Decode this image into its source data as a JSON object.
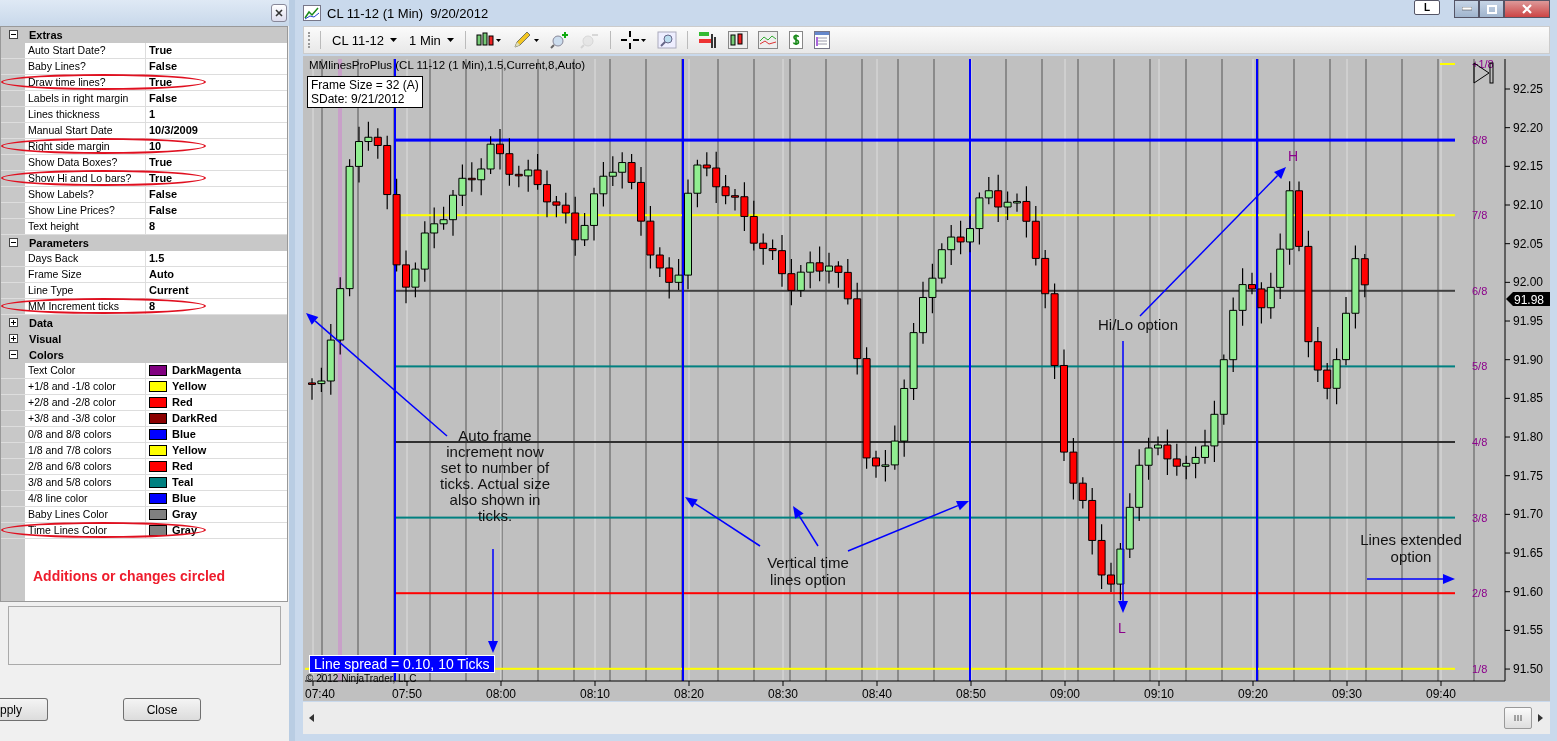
{
  "settings_panel": {
    "groups": [
      {
        "name": "Extras",
        "expanded": true,
        "rows": [
          {
            "label": "Auto Start Date?",
            "value": "True",
            "circled": false
          },
          {
            "label": "Baby Lines?",
            "value": "False",
            "circled": false
          },
          {
            "label": "Draw time lines?",
            "value": "True",
            "circled": true
          },
          {
            "label": "Labels in right margin",
            "value": "False",
            "circled": false
          },
          {
            "label": "Lines thickness",
            "value": "1",
            "circled": false
          },
          {
            "label": "Manual Start Date",
            "value": "10/3/2009",
            "circled": false
          },
          {
            "label": "Right side margin",
            "value": "10",
            "circled": true
          },
          {
            "label": "Show Data Boxes?",
            "value": "True",
            "circled": false
          },
          {
            "label": "Show Hi and Lo bars?",
            "value": "True",
            "circled": true
          },
          {
            "label": "Show Labels?",
            "value": "False",
            "circled": false
          },
          {
            "label": "Show Line Prices?",
            "value": "False",
            "circled": false
          },
          {
            "label": "Text height",
            "value": "8",
            "circled": false
          }
        ]
      },
      {
        "name": "Parameters",
        "expanded": true,
        "rows": [
          {
            "label": "Days Back",
            "value": "1.5",
            "circled": false
          },
          {
            "label": "Frame Size",
            "value": "Auto",
            "circled": false
          },
          {
            "label": "Line Type",
            "value": "Current",
            "circled": false
          },
          {
            "label": "MM Increment ticks",
            "value": "8",
            "circled": true
          }
        ]
      },
      {
        "name": "Data",
        "expanded": false
      },
      {
        "name": "Visual",
        "expanded": false
      },
      {
        "name": "Colors",
        "expanded": true,
        "rows": [
          {
            "label": "Text Color",
            "value": "DarkMagenta",
            "color": "#800080",
            "circled": false
          },
          {
            "label": "+1/8 and -1/8 color",
            "value": "Yellow",
            "color": "#ffff00",
            "circled": false
          },
          {
            "label": "+2/8 and -2/8 color",
            "value": "Red",
            "color": "#ff0000",
            "circled": false
          },
          {
            "label": "+3/8 and -3/8 color",
            "value": "DarkRed",
            "color": "#8b0000",
            "circled": false
          },
          {
            "label": "0/8 and 8/8 colors",
            "value": "Blue",
            "color": "#0000ff",
            "circled": false
          },
          {
            "label": "1/8 and 7/8 colors",
            "value": "Yellow",
            "color": "#ffff00",
            "circled": false
          },
          {
            "label": "2/8 and 6/8 colors",
            "value": "Red",
            "color": "#ff0000",
            "circled": false
          },
          {
            "label": "3/8 and 5/8 colors",
            "value": "Teal",
            "color": "#008080",
            "circled": false
          },
          {
            "label": "4/8 line color",
            "value": "Blue",
            "color": "#0000ff",
            "circled": false
          },
          {
            "label": "Baby Lines Color",
            "value": "Gray",
            "color": "#808080",
            "circled": false
          },
          {
            "label": "Time Lines Color",
            "value": "Gray",
            "color": "#808080",
            "circled": true
          }
        ]
      }
    ],
    "note": "Additions or changes circled",
    "buttons": [
      "pply",
      "Close"
    ]
  },
  "desktop_button": "L",
  "chart_window": {
    "title": "CL 11-12 (1 Min)  9/20/2012",
    "toolbar": {
      "instrument": "CL 11-12",
      "interval": "1 Min"
    },
    "indicator_label": "MMlinesProPlus (CL 11-12 (1 Min),1.5,Current,8,Auto)",
    "info_box": [
      "Frame Size = 32 (A)",
      "SDate: 9/21/2012"
    ],
    "mm_lines": [
      {
        "label": "+1/8",
        "color": "#ffff00"
      },
      {
        "label": "8/8",
        "color": "#0000ff"
      },
      {
        "label": "7/8",
        "color": "#ffff00"
      },
      {
        "label": "6/8",
        "color": "#404040"
      },
      {
        "label": "5/8",
        "color": "#008080"
      },
      {
        "label": "4/8",
        "color": "#303030"
      },
      {
        "label": "3/8",
        "color": "#008080"
      },
      {
        "label": "2/8",
        "color": "#ff0000"
      },
      {
        "label": "1/8",
        "color": "#ffff00"
      }
    ],
    "price_axis": [
      "92.25",
      "92.20",
      "92.15",
      "92.10",
      "92.05",
      "92.00",
      "91.95",
      "91.90",
      "91.85",
      "91.80",
      "91.75",
      "91.70",
      "91.65",
      "91.60",
      "91.55",
      "91.50"
    ],
    "current_price": "91.98",
    "time_axis": [
      "07:40",
      "07:50",
      "08:00",
      "08:10",
      "08:20",
      "08:30",
      "08:40",
      "08:50",
      "09:00",
      "09:10",
      "09:20",
      "09:30",
      "09:40"
    ],
    "hi_marker": "H",
    "lo_marker": "L",
    "spread_label": "Line spread = 0.10, 10 Ticks",
    "copyright": "© 2012 NinjaTrader, LLC",
    "annotations": [
      "Auto frame increment now set to number of ticks. Actual size also shown in ticks.",
      "Vertical time lines option",
      "Hi/Lo option",
      "Lines extended option"
    ]
  }
}
